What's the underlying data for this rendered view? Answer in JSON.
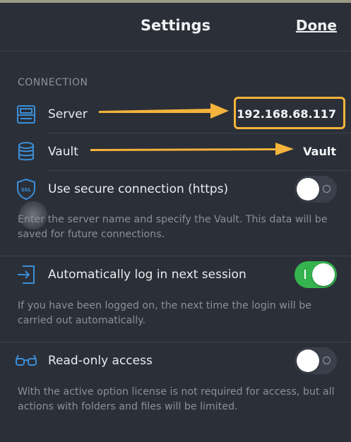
{
  "header": {
    "title": "Settings",
    "done_label": "Done"
  },
  "connection": {
    "section_label": "CONNECTION",
    "server": {
      "label": "Server",
      "value": "192.168.68.117",
      "icon": "server-icon"
    },
    "vault": {
      "label": "Vault",
      "value": "Vault",
      "icon": "database-icon"
    },
    "secure": {
      "label": "Use secure connection (https)",
      "icon": "shield-ssl-icon",
      "enabled": false,
      "badge_text": "SSL"
    },
    "description": "Enter the server name and specify the Vault. This data will be saved for future connections."
  },
  "auto_login": {
    "label": "Automatically log in next session",
    "icon": "login-icon",
    "enabled": true,
    "description": "If you have been logged on, the next time the login will be carried out automatically."
  },
  "read_only": {
    "label": "Read-only access",
    "icon": "glasses-icon",
    "enabled": false,
    "description": "With the active option license is not required for access, but all actions with folders and files will be limited."
  },
  "colors": {
    "background": "#2b2f38",
    "icon_blue": "#3a8fd8",
    "toggle_on": "#34b34f",
    "annotation_orange": "#f4b33a"
  }
}
